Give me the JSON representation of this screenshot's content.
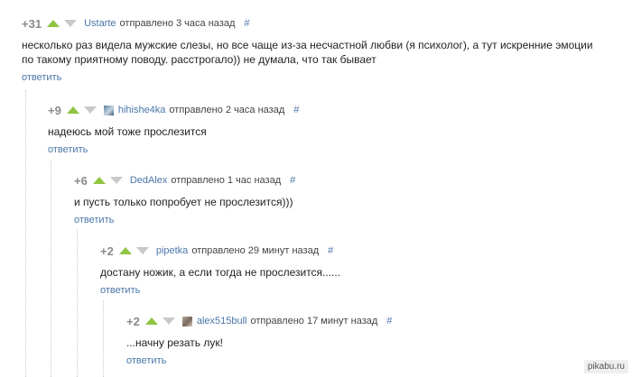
{
  "comments": [
    {
      "rating": "+31",
      "author": "Ustarte",
      "sent": "отправлено 3 часа назад",
      "hash": "#",
      "text_lines": [
        "несколько раз видела мужские слезы, но все чаще из-за несчастной любви (я психолог), а тут искренние эмоции",
        "по такому приятному поводу. расстрогало)) не думала, что так бывает"
      ],
      "reply": "ответить"
    },
    {
      "rating": "+9",
      "author": "hihishe4ka",
      "sent": "отправлено 2 часа назад",
      "hash": "#",
      "text_lines": [
        "надеюсь мой тоже прослезится"
      ],
      "reply": "ответить",
      "avatar": "user-avatar"
    },
    {
      "rating": "+6",
      "author": "DedAlex",
      "sent": "отправлено 1 час назад",
      "hash": "#",
      "text_lines": [
        "и пусть только попробует не прослезится)))"
      ],
      "reply": "ответить"
    },
    {
      "rating": "+2",
      "author": "pipetka",
      "sent": "отправлено 29 минут назад",
      "hash": "#",
      "text_lines": [
        "достану ножик, а если тогда не прослезится......"
      ],
      "reply": "ответить"
    },
    {
      "rating": "+2",
      "author": "alex515bull",
      "sent": "отправлено 17 минут назад",
      "hash": "#",
      "text_lines": [
        "...начну резать лук!"
      ],
      "reply": "ответить",
      "avatar": "user-avatar"
    }
  ],
  "watermark": "pikabu.ru",
  "colors": {
    "link": "#4a76a8",
    "vote_up": "#8fc641",
    "vote_down": "#c9c9c9"
  },
  "icons": {
    "upvote": "triangle-up-icon",
    "downvote": "triangle-down-icon"
  }
}
